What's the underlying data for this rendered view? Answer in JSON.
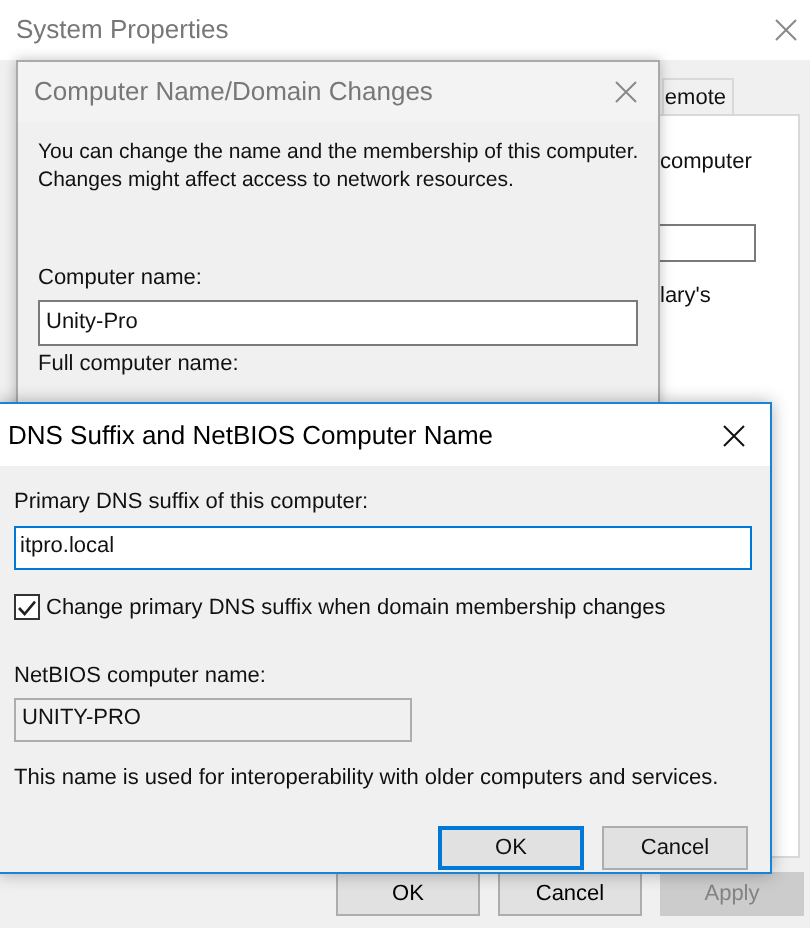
{
  "system_properties": {
    "title": "System Properties",
    "active": false,
    "tab": {
      "label": "emote",
      "selected": false
    },
    "panel_texts": [
      "computer",
      "lary's"
    ],
    "buttons": [
      {
        "label": "OK",
        "disabled": false
      },
      {
        "label": "Cancel",
        "disabled": false
      },
      {
        "label": "Apply",
        "disabled": true
      }
    ]
  },
  "computer_name_dialog": {
    "title": "Computer Name/Domain Changes",
    "active": false,
    "description": "You can change the name and the membership of this computer. Changes might affect access to network resources.",
    "computer_name_label": "Computer name:",
    "computer_name": "Unity-Pro",
    "full_name_label": "Full computer name:"
  },
  "dns_dialog": {
    "title": "DNS Suffix and NetBIOS Computer Name",
    "active": true,
    "suffix_label": "Primary DNS suffix of this computer:",
    "suffix_value": "itpro.local",
    "change_suffix": {
      "label": "Change primary DNS suffix when domain membership changes",
      "checked": true
    },
    "netbios_label": "NetBIOS computer name:",
    "netbios_value": "UNITY-PRO",
    "netbios_disabled": true,
    "note": "This name is used for interoperability with older computers and services.",
    "buttons": [
      {
        "label": "OK",
        "default": true
      },
      {
        "label": "Cancel",
        "default": false
      }
    ]
  }
}
